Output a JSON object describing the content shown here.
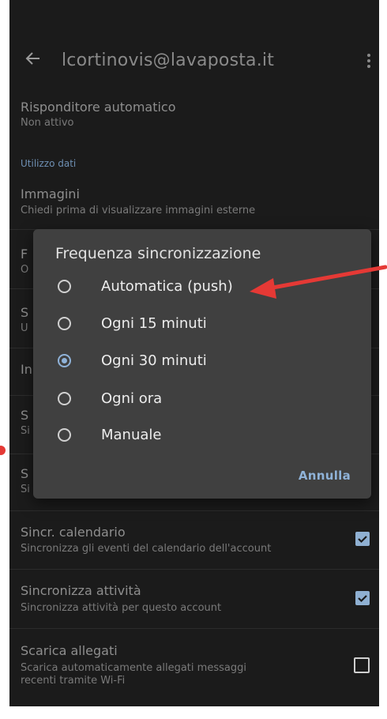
{
  "header": {
    "title": "lcortinovis@lavaposta.it"
  },
  "prefs": {
    "autoreply": {
      "title": "Risponditore automatico",
      "summary": "Non attivo"
    },
    "data_section": "Utilizzo dati",
    "images": {
      "title": "Immagini",
      "summary": "Chiedi prima di visualizzare immagini esterne"
    },
    "hidden": [
      "F",
      "O",
      "S",
      "U",
      "In",
      "S",
      "Si",
      "S",
      "Si"
    ],
    "calendar": {
      "title": "Sincr. calendario",
      "summary": "Sincronizza gli eventi del calendario dell'account",
      "checked": true
    },
    "tasks": {
      "title": "Sincronizza attività",
      "summary": "Sincronizza attività per questo account",
      "checked": true
    },
    "attachments": {
      "title": "Scarica allegati",
      "summary_line1": "Scarica automaticamente allegati messaggi",
      "summary_line2": "recenti tramite Wi-Fi",
      "checked": false
    }
  },
  "dialog": {
    "title": "Frequenza sincronizzazione",
    "options": [
      {
        "label": "Automatica (push)",
        "selected": false
      },
      {
        "label": "Ogni 15 minuti",
        "selected": false
      },
      {
        "label": "Ogni 30 minuti",
        "selected": true
      },
      {
        "label": "Ogni ora",
        "selected": false
      },
      {
        "label": "Manuale",
        "selected": false
      }
    ],
    "cancel_label": "Annulla"
  },
  "colors": {
    "accent": "#8fb2d8",
    "annotation": "#e53935",
    "dialog_bg": "#404040",
    "screen_bg": "#1b1b1b"
  }
}
